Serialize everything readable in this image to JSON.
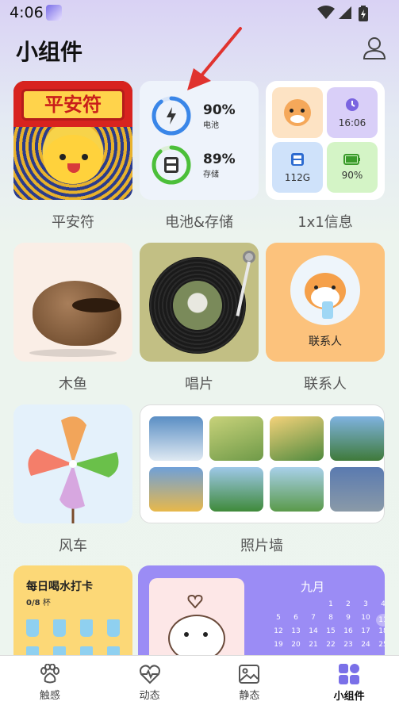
{
  "status_bar": {
    "time": "4:06"
  },
  "header": {
    "title": "小组件"
  },
  "widgets": {
    "pinganfu": {
      "title": "平安符",
      "label": "平安符"
    },
    "battery_storage": {
      "label": "电池&存储",
      "battery": {
        "value": "90%",
        "sub": "电池",
        "level": 0.9
      },
      "storage": {
        "value": "89%",
        "sub": "存储",
        "level": 0.89
      }
    },
    "info1x1": {
      "label": "1x1信息",
      "time": "16:06",
      "storage": "112G",
      "battery": "90%"
    },
    "muyu": {
      "label": "木鱼"
    },
    "record": {
      "label": "唱片"
    },
    "contact": {
      "label": "联系人",
      "name": "联系人"
    },
    "windmill": {
      "label": "风车"
    },
    "photowall": {
      "label": "照片墙"
    },
    "water": {
      "title": "每日喝水打卡",
      "progress": "0/8",
      "unit": "杯"
    },
    "calendar": {
      "month": "九月",
      "rows": [
        [
          "",
          "",
          "",
          "1",
          "2",
          "3",
          "4"
        ],
        [
          "5",
          "6",
          "7",
          "8",
          "9",
          "10",
          "11"
        ],
        [
          "12",
          "13",
          "14",
          "15",
          "16",
          "17",
          "18"
        ],
        [
          "19",
          "20",
          "21",
          "22",
          "23",
          "24",
          "25"
        ],
        [
          "",
          "",
          "",
          "",
          "",
          "",
          ""
        ]
      ],
      "visible": [
        "1",
        "2",
        "3",
        "4",
        "5",
        "6",
        "7",
        "8",
        "9",
        "10",
        "11",
        "12",
        "13",
        "14",
        "15",
        "16",
        "17",
        "18",
        "19",
        "20",
        "21",
        "22",
        "23",
        "24",
        "25"
      ],
      "today": "11"
    }
  },
  "bottom_nav": {
    "items": [
      {
        "label": "触感",
        "icon": "paw-icon"
      },
      {
        "label": "动态",
        "icon": "heart-pulse-icon"
      },
      {
        "label": "静态",
        "icon": "image-icon"
      },
      {
        "label": "小组件",
        "icon": "widgets-icon",
        "active": true
      }
    ]
  },
  "colors": {
    "accent_purple": "#9b8cf5",
    "battery_blue": "#3a86e8",
    "storage_green": "#4cbf3a"
  }
}
